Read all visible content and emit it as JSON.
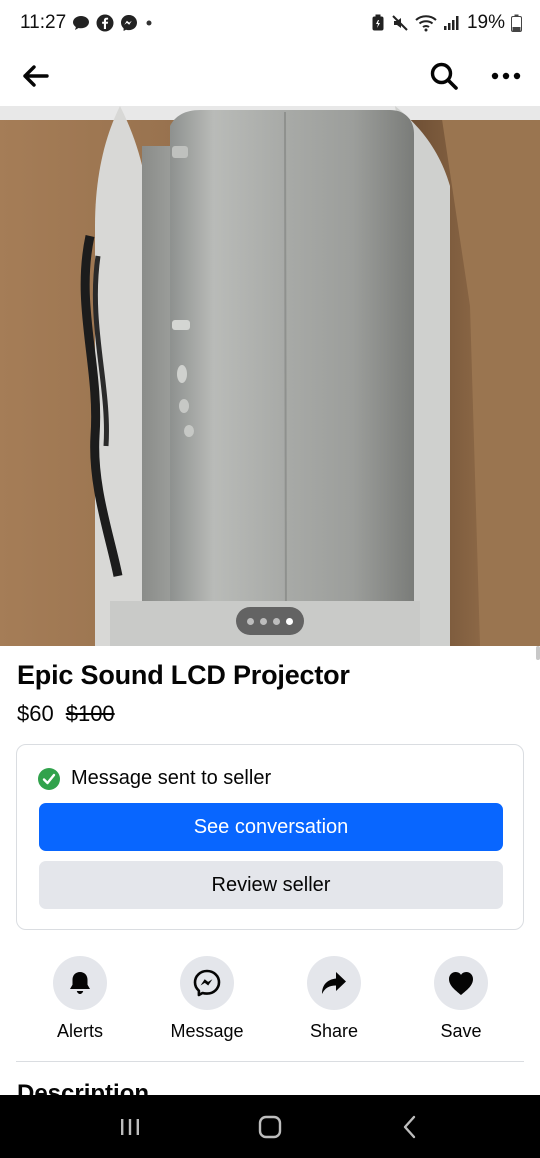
{
  "status_bar": {
    "time": "11:27",
    "battery": "19%",
    "notification_icons": [
      "chat-bubble-icon",
      "facebook-icon",
      "messenger-icon",
      "dot-icon"
    ],
    "system_icons": [
      "battery-saver-icon",
      "mute-icon",
      "wifi-icon",
      "signal-icon",
      "battery-icon"
    ]
  },
  "nav": {
    "back_icon": "back-arrow-icon",
    "search_icon": "search-icon",
    "more_icon": "more-icon"
  },
  "carousel": {
    "count": 4,
    "active_index": 3
  },
  "listing": {
    "title": "Epic Sound LCD Projector",
    "price": "$60",
    "original_price": "$100"
  },
  "message_card": {
    "status_text": "Message sent to seller",
    "primary_button": "See conversation",
    "secondary_button": "Review seller"
  },
  "actions": [
    {
      "label": "Alerts",
      "icon": "bell-icon"
    },
    {
      "label": "Message",
      "icon": "messenger-icon"
    },
    {
      "label": "Share",
      "icon": "share-arrow-icon"
    },
    {
      "label": "Save",
      "icon": "heart-icon"
    }
  ],
  "description": {
    "heading": "Description"
  },
  "colors": {
    "primary": "#0866ff",
    "secondary_bg": "#e4e6eb",
    "success": "#31a24c"
  }
}
